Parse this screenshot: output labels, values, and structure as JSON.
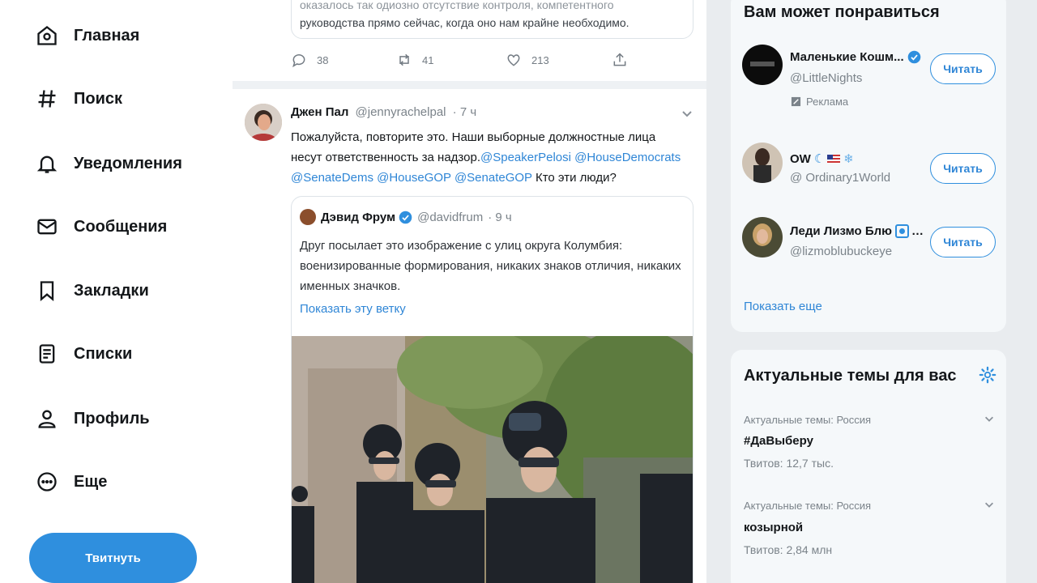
{
  "nav": {
    "items": [
      {
        "label": "Главная",
        "icon": "home-icon"
      },
      {
        "label": "Поиск",
        "icon": "hash-icon"
      },
      {
        "label": "Уведомления",
        "icon": "bell-icon"
      },
      {
        "label": "Сообщения",
        "icon": "mail-icon"
      },
      {
        "label": "Закладки",
        "icon": "bookmark-icon"
      },
      {
        "label": "Списки",
        "icon": "list-icon"
      },
      {
        "label": "Профиль",
        "icon": "person-icon"
      },
      {
        "label": "Еще",
        "icon": "more-circle-icon"
      }
    ],
    "tweet_button": "Твитнуть"
  },
  "prev_tweet": {
    "quote_line1": "оказалось так одиозно отсутствие контроля, компетентного",
    "quote_line2": "руководства прямо сейчас, когда оно нам крайне необходимо.",
    "replies": "38",
    "retweets": "41",
    "likes": "213"
  },
  "tweet": {
    "name": "Джен Пал",
    "handle": "@jennyrachelpal",
    "time": "· 7 ч",
    "text_part1": "Пожалуйста, повторите это. Наши выборные должностные лица несут ответственность за надзор.",
    "mention1": "@SpeakerPelosi",
    "mention2": "@HouseDemocrats",
    "mention3": "@SenateDems",
    "mention4": "@HouseGOP",
    "mention5": "@SenateGOP",
    "text_part2": " Кто эти люди?",
    "quoted": {
      "name": "Дэвид Фрум",
      "handle": "@davidfrum",
      "time": "· 9 ч",
      "text": "Друг посылает это изображение с улиц округа Колумбия: военизированные формирования, никаких знаков отличия, никаких именных значков.",
      "thread_link": "Показать эту ветку"
    }
  },
  "suggestions": {
    "title": "Вам может понравиться",
    "items": [
      {
        "name": "Маленькие Кошм...",
        "handle": "@LittleNights",
        "follow": "Читать",
        "promo": "Реклама"
      },
      {
        "name": "OW",
        "handle": "@ Ordinary1World",
        "follow": "Читать"
      },
      {
        "name": "Леди Лизмо Блю",
        "handle": "@lizmoblubuckeye",
        "follow": "Читать"
      }
    ],
    "show_more": "Показать еще"
  },
  "trends": {
    "title": "Актуальные темы для вас",
    "items": [
      {
        "category": "Актуальные темы: Россия",
        "name": "#ДаВыберу",
        "count": "Твитов: 12,7 тыс."
      },
      {
        "category": "Актуальные темы: Россия",
        "name": "козырной",
        "count": "Твитов: 2,84 млн"
      }
    ]
  },
  "colors": {
    "accent": "#2f8fde",
    "link": "#2f86d6",
    "text": "#14171a",
    "muted": "#7b838a",
    "panel": "#f5f8fa"
  }
}
